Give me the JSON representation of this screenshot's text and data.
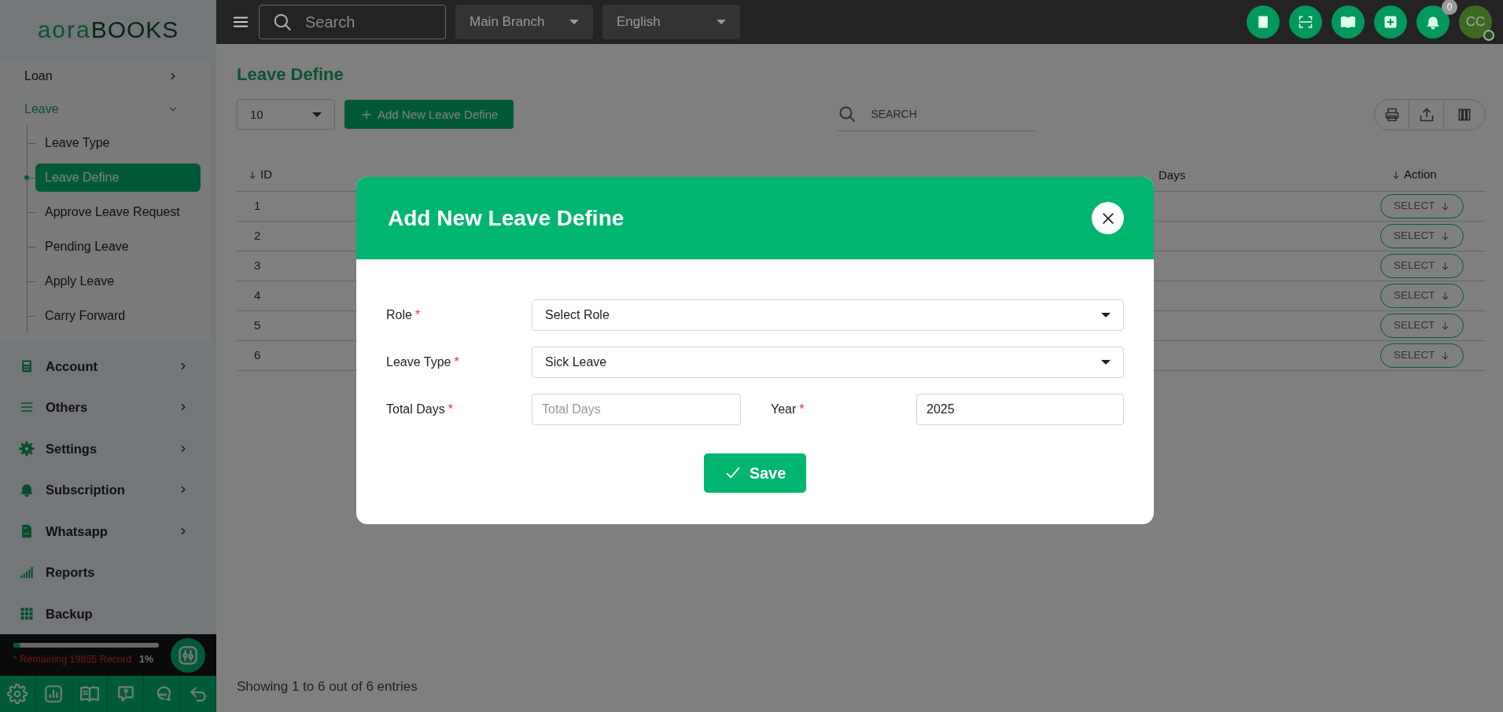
{
  "sidebar": {
    "logo": {
      "part_1": "aora",
      "part_2": "BOOKS"
    },
    "submenu": [
      {
        "label": "Loan",
        "expanded": false
      },
      {
        "label": "Leave",
        "expanded": true,
        "children": [
          {
            "label": "Leave Type",
            "selected": false
          },
          {
            "label": "Leave Define",
            "selected": true
          },
          {
            "label": "Approve Leave Request",
            "selected": false
          },
          {
            "label": "Pending Leave",
            "selected": false
          },
          {
            "label": "Apply Leave",
            "selected": false
          },
          {
            "label": "Carry Forward",
            "selected": false
          }
        ]
      }
    ],
    "items": [
      {
        "label": "Account",
        "expanded": false
      },
      {
        "label": "Others",
        "expanded": false
      },
      {
        "label": "Settings",
        "expanded": false
      },
      {
        "label": "Subscription",
        "expanded": false
      },
      {
        "label": "Whatsapp",
        "expanded": false
      },
      {
        "label": "Reports"
      },
      {
        "label": "Backup"
      }
    ],
    "storage": {
      "level": 0.05,
      "text": "* Remaining 19855 Record",
      "percent": "1%"
    }
  },
  "topbar": {
    "search": {
      "placeholder": "Search"
    },
    "branch": "Main Branch",
    "language": "English",
    "notification_count": "0",
    "avatar": "CC"
  },
  "page": {
    "title": "Leave Define",
    "page_size": "10",
    "add_button": "Add New Leave Define",
    "search": {
      "placeholder": "SEARCH"
    }
  },
  "table": {
    "columns": [
      "ID",
      "Days",
      "Action"
    ],
    "rows": [
      {
        "id": "1",
        "action": "SELECT"
      },
      {
        "id": "2",
        "action": "SELECT"
      },
      {
        "id": "3",
        "action": "SELECT"
      },
      {
        "id": "4",
        "action": "SELECT"
      },
      {
        "id": "5",
        "action": "SELECT"
      },
      {
        "id": "6",
        "action": "SELECT"
      }
    ],
    "footer": "Showing 1 to 6 out of 6 entries"
  },
  "modal": {
    "title": "Add New Leave Define",
    "fields": [
      {
        "label": "Role",
        "required_mark": "*",
        "kind": "select",
        "value": "Select Role"
      },
      {
        "label": "Leave Type",
        "required_mark": "*",
        "kind": "select",
        "value": "Sick Leave"
      },
      {
        "label": "Total Days",
        "required_mark": "*",
        "kind": "input",
        "placeholder": "Total Days"
      },
      {
        "label": "Year",
        "required_mark": "*",
        "kind": "input",
        "value": "2025"
      }
    ],
    "save_button": "Save"
  }
}
